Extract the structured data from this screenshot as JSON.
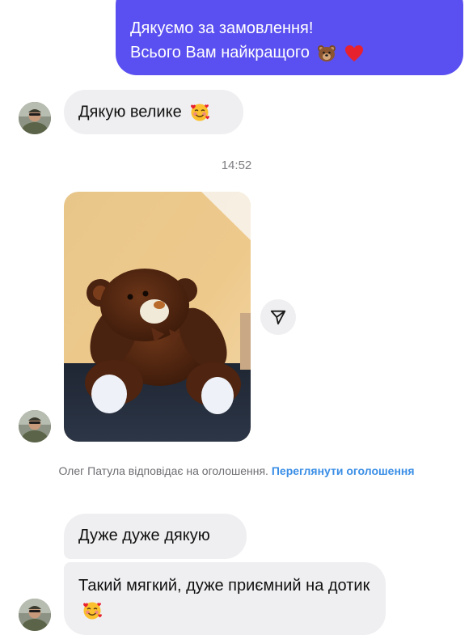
{
  "messages": {
    "outgoing_thanks": {
      "line1": "Дякуємо за замовлення!",
      "line2": "Всього Вам найкращого"
    },
    "reply_thanks": "Дякую велике",
    "timestamp": "14:52",
    "listing_notice": {
      "text": "Олег Патула відповідає на оголошення.",
      "link": "Переглянути оголошення"
    },
    "reply_very_thanks": "Дуже дуже дякую",
    "reply_soft": "Такий мягкий, дуже приємний на дотик"
  },
  "icons": {
    "bear": "bear-face-emoji",
    "heart": "red-heart-emoji",
    "smile": "smiling-face-with-hearts-emoji",
    "share": "paper-plane-icon"
  },
  "colors": {
    "outgoing_bubble": "#5a4ff0",
    "incoming_bubble": "#efeff1",
    "link": "#3a8ee6"
  }
}
